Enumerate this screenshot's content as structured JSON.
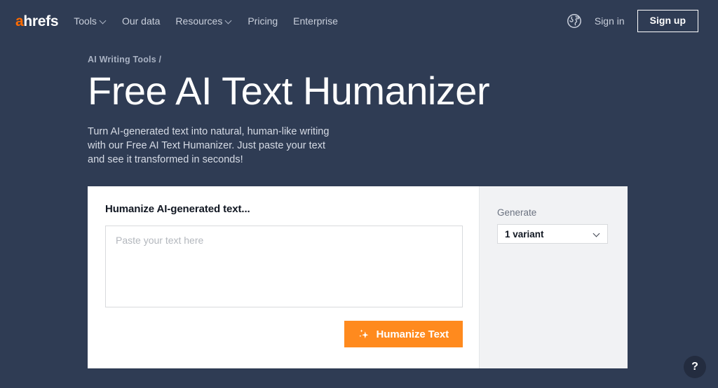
{
  "header": {
    "logo": {
      "accent": "a",
      "rest": "hrefs"
    },
    "nav": [
      {
        "label": "Tools",
        "has_chevron": true
      },
      {
        "label": "Our data",
        "has_chevron": false
      },
      {
        "label": "Resources",
        "has_chevron": true
      },
      {
        "label": "Pricing",
        "has_chevron": false
      },
      {
        "label": "Enterprise",
        "has_chevron": false
      }
    ],
    "language_icon": "globe-icon",
    "sign_in": "Sign in",
    "sign_up": "Sign up"
  },
  "hero": {
    "breadcrumb": "AI Writing Tools /",
    "title": "Free AI Text Humanizer",
    "description": "Turn AI-generated text into natural, human-like writing with our Free AI Text Humanizer. Just paste your text and see it transformed in seconds!"
  },
  "tool": {
    "heading": "Humanize AI-generated text...",
    "input_placeholder": "Paste your text here",
    "input_value": "",
    "submit_label": "Humanize Text",
    "submit_icon": "sparkles-icon",
    "generate_label": "Generate",
    "variant_selected": "1 variant",
    "variant_options": [
      "1 variant"
    ]
  },
  "help": {
    "label": "?",
    "icon": "question-mark-icon"
  },
  "colors": {
    "background": "#2f3c54",
    "accent_orange": "#ff6b00",
    "button_orange": "#ff8a1e",
    "card_white": "#ffffff",
    "panel_gray": "#f1f2f4"
  }
}
